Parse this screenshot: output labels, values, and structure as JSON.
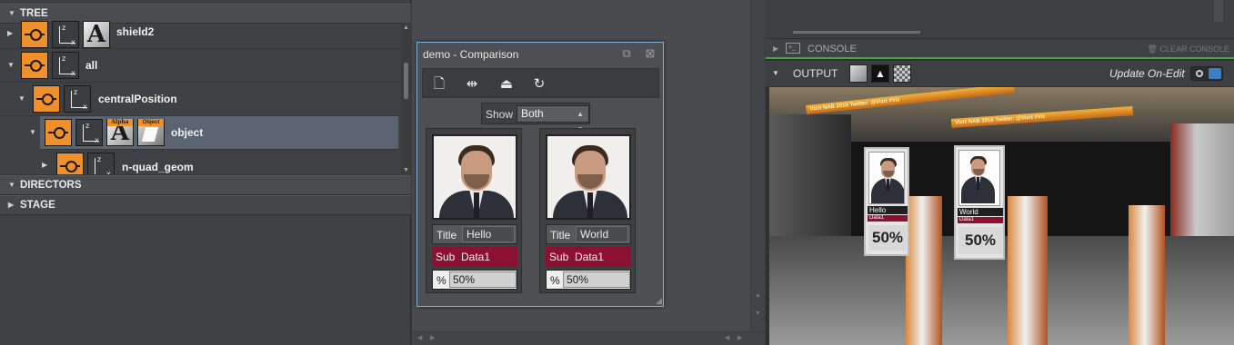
{
  "tree": {
    "header": "TREE",
    "items": [
      {
        "label": "shield2"
      },
      {
        "label": "all"
      },
      {
        "label": "centralPosition"
      },
      {
        "label": "object",
        "badge_alpha": "Alpha",
        "badge_object": "Object"
      },
      {
        "label": "n-quad_geom"
      }
    ],
    "directors": "DIRECTORS",
    "stage": "STAGE"
  },
  "dialog": {
    "title": "demo  - Comparison",
    "show_label": "Show",
    "show_value": "Both",
    "cards": [
      {
        "title_label": "Title",
        "title_value": "Hello",
        "sub_label": "Sub",
        "sub_value": "Data1",
        "pct_label": "%",
        "pct_value": "50%"
      },
      {
        "title_label": "Title",
        "title_value": "World",
        "sub_label": "Sub",
        "sub_value": "Data1",
        "pct_label": "%",
        "pct_value": "50%"
      }
    ]
  },
  "console": {
    "label": "CONSOLE",
    "clear": "CLEAR CONSOLE"
  },
  "output": {
    "label": "OUTPUT",
    "update_label": "Update On-Edit"
  },
  "scene": {
    "banner_text": "Vizrt NAB 2016 Twitter: @Vizrt #Viz",
    "cards": [
      {
        "title": "Hello",
        "sub": "Data1",
        "pct": "50%"
      },
      {
        "title": "World",
        "sub": "Data1",
        "pct": "50%"
      }
    ]
  },
  "colors": {
    "accent_orange": "#f0902a",
    "sub_red": "#8c1131",
    "dialog_border": "#7fb4d8",
    "console_green": "#4aa34a"
  }
}
